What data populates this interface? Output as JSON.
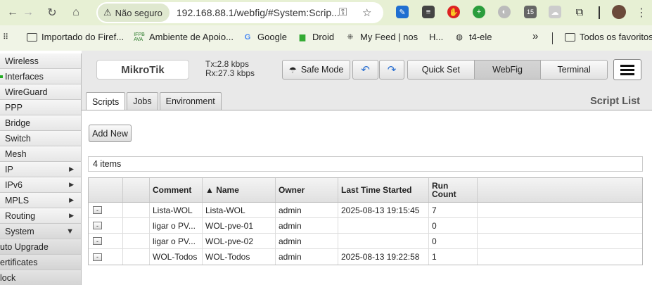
{
  "browser": {
    "security_label": "Não seguro",
    "url": "192.168.88.1/webfig/#System:Scrip...",
    "extension_badge": "15"
  },
  "bookmarks": [
    {
      "label": "Importado do Firef..."
    },
    {
      "label": "Ambiente de Apoio..."
    },
    {
      "label": "Google"
    },
    {
      "label": "Droid"
    },
    {
      "label": "My Feed | nos"
    },
    {
      "label": "H..."
    },
    {
      "label": "t4-ele"
    }
  ],
  "bookmarks_overflow": "»",
  "bookmarks_all": "Todos os favoritos",
  "sidebar": {
    "items": [
      {
        "label": "Wireless",
        "arrow": ""
      },
      {
        "label": "Interfaces",
        "arrow": ""
      },
      {
        "label": "WireGuard",
        "arrow": ""
      },
      {
        "label": "PPP",
        "arrow": ""
      },
      {
        "label": "Bridge",
        "arrow": ""
      },
      {
        "label": "Switch",
        "arrow": ""
      },
      {
        "label": "Mesh",
        "arrow": ""
      },
      {
        "label": "IP",
        "arrow": "▶"
      },
      {
        "label": "IPv6",
        "arrow": "▶"
      },
      {
        "label": "MPLS",
        "arrow": "▶"
      },
      {
        "label": "Routing",
        "arrow": "▶"
      },
      {
        "label": "System",
        "arrow": "▼"
      },
      {
        "label": "uto Upgrade",
        "arrow": ""
      },
      {
        "label": "ertificates",
        "arrow": ""
      },
      {
        "label": "lock",
        "arrow": ""
      }
    ]
  },
  "header": {
    "brand": "MikroTik",
    "tx": "Tx:2.8 kbps",
    "rx": "Rx:27.3 kbps",
    "safe_mode": "Safe Mode",
    "modes": [
      "Quick Set",
      "WebFig",
      "Terminal"
    ],
    "active_mode": "WebFig"
  },
  "tabs": [
    "Scripts",
    "Jobs",
    "Environment"
  ],
  "section_title": "Script List",
  "add_new": "Add New",
  "items_count": "4 items",
  "table": {
    "columns": [
      "",
      "",
      "Comment",
      "▲ Name",
      "Owner",
      "Last Time Started",
      "Run Count",
      ""
    ],
    "rows": [
      {
        "remove": "-",
        "comment": "Lista-WOL",
        "name": "Lista-WOL",
        "owner": "admin",
        "last_started": "2025-08-13 19:15:45",
        "run_count": "7"
      },
      {
        "remove": "-",
        "comment": "ligar o PV...",
        "name": "WOL-pve-01",
        "owner": "admin",
        "last_started": "",
        "run_count": "0"
      },
      {
        "remove": "-",
        "comment": "ligar o PV...",
        "name": "WOL-pve-02",
        "owner": "admin",
        "last_started": "",
        "run_count": "0"
      },
      {
        "remove": "-",
        "comment": "WOL-Todos",
        "name": "WOL-Todos",
        "owner": "admin",
        "last_started": "2025-08-13 19:22:58",
        "run_count": "1"
      }
    ]
  },
  "colors": {
    "browser_bar": "#e7f0d4",
    "panel_bg": "#e9e9e9"
  }
}
